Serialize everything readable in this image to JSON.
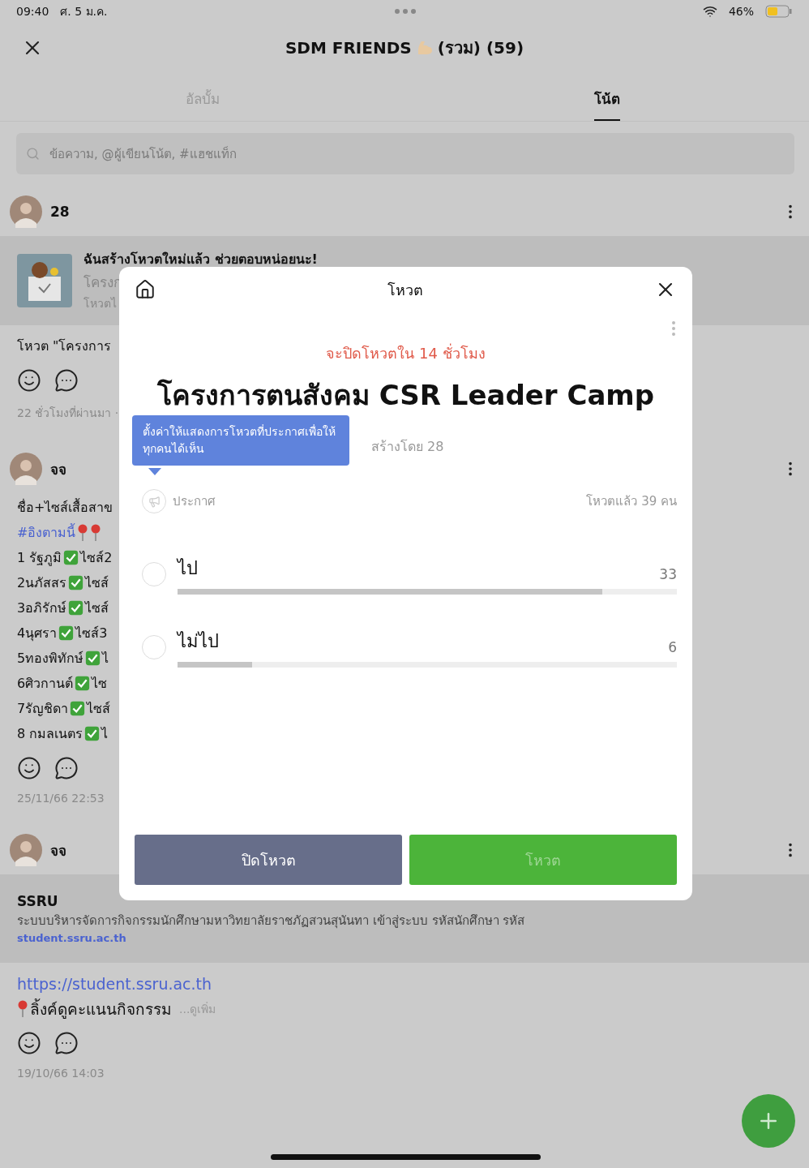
{
  "status_bar": {
    "time": "09:40",
    "date": "ศ. 5 ม.ค.",
    "battery": "46%"
  },
  "header": {
    "title": "SDM FRIENDS",
    "title_suffix": "(รวม) (59)"
  },
  "tabs": [
    {
      "label": "อัลบั้ม",
      "selected": false
    },
    {
      "label": "โน้ต",
      "selected": true
    }
  ],
  "search": {
    "placeholder": "ข้อความ, @ผู้เขียนโน้ต, #แฮชแท็ก"
  },
  "posts": [
    {
      "author": "28",
      "attachment": {
        "kind": "poll",
        "title": "ฉันสร้างโหวตใหม่แล้ว ช่วยตอบหน่อยนะ!",
        "lines": [
          "โครงก",
          "โหวตไ"
        ]
      },
      "body": [
        {
          "kind": "text",
          "text": "โหวต \"โครงการ"
        }
      ],
      "time": "22 ชั่วโมงที่ผ่านมา ·"
    },
    {
      "author": "จจ",
      "body": [
        {
          "kind": "text",
          "text": "ชื่อ+ไซส์เสื้อสาข"
        },
        {
          "kind": "hashtag",
          "text": "#อิงตามนี้"
        },
        {
          "kind": "check",
          "text": "1 รัฐภูมิ",
          "after": "ไซส์2"
        },
        {
          "kind": "check",
          "text": "2นภัสสร",
          "after": "ไซส์"
        },
        {
          "kind": "check",
          "text": "3อภิรักษ์",
          "after": "ไซส์"
        },
        {
          "kind": "check",
          "text": "4นุศรา",
          "after": "ไซส์3"
        },
        {
          "kind": "check",
          "text": "5ทองพิทักษ์",
          "after": "ไ"
        },
        {
          "kind": "check",
          "text": "6ศิวกานต์",
          "after": "ไซ"
        },
        {
          "kind": "check",
          "text": "7รัญชิดา",
          "after": "ไซส์"
        },
        {
          "kind": "check",
          "text": "8 กมลเนตร",
          "after": "ไ"
        }
      ],
      "time": "25/11/66 22:53"
    },
    {
      "author": "จจ",
      "attachment": {
        "kind": "link",
        "title": "SSRU",
        "description": "ระบบบริหารจัดการกิจกรรมนักศึกษามหาวิทยาลัยราชภัฏสวนสุนันทา เข้าสู่ระบบ รหัสนักศึกษา รหัส",
        "domain": "student.ssru.ac.th"
      },
      "body": [
        {
          "kind": "link",
          "text": "https://student.ssru.ac.th"
        },
        {
          "kind": "pin",
          "text": "ลิ้งค์ดูคะแนนกิจกรรม",
          "more": "...ดูเพิ่ม"
        }
      ],
      "time": "19/10/66 14:03"
    }
  ],
  "poll_dialog": {
    "title": "โหวต",
    "deadline": "จะปิดโหวตใน 14 ชั่วโมง",
    "question": "โครงการตนสังคม CSR Leader Camp",
    "tooltip": "ตั้งค่าให้แสดงการโหวตที่ประกาศเพื่อให้ทุกคนได้เห็น",
    "creator": "สร้างโดย 28",
    "announce": "ประกาศ",
    "voters": "โหวตแล้ว 39 คน",
    "options": [
      {
        "label": "ไป",
        "count": "33",
        "level": 0.85,
        "selected": false
      },
      {
        "label": "ไม่ไป",
        "count": "6",
        "level": 0.15,
        "selected": false
      }
    ],
    "buttons": [
      {
        "label": "ปิดโหวต",
        "kind": "close",
        "disabled": false
      },
      {
        "label": "โหวต",
        "kind": "vote",
        "disabled": true
      }
    ]
  }
}
